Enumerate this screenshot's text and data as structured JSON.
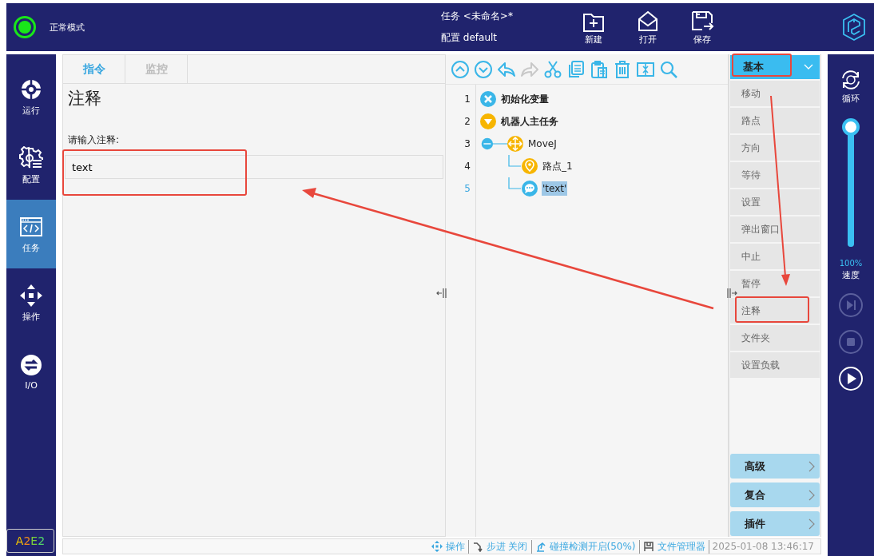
{
  "top_bar": {
    "mode": "正常模式",
    "task_label": "任务",
    "task_value": "<未命名>*",
    "config_label": "配置",
    "config_value": "default",
    "buttons": [
      {
        "kind": "new",
        "label": "新建"
      },
      {
        "kind": "open",
        "label": "打开"
      },
      {
        "kind": "save",
        "label": "保存"
      }
    ]
  },
  "sidebar": {
    "items": [
      {
        "kind": "run",
        "label": "运行",
        "selected": false
      },
      {
        "kind": "config",
        "label": "配置",
        "selected": false
      },
      {
        "kind": "task",
        "label": "任务",
        "selected": true
      },
      {
        "kind": "operate",
        "label": "操作",
        "selected": false
      },
      {
        "kind": "io",
        "label": "I/O",
        "selected": false
      }
    ],
    "badge": [
      {
        "text": "A",
        "color": "#f2c200"
      },
      {
        "text": "2",
        "color": "#f08a1c"
      },
      {
        "text": "E",
        "color": "#7bd13a"
      },
      {
        "text": "2",
        "color": "#52d96a"
      }
    ]
  },
  "tabs": [
    {
      "label": "指令",
      "selected": true
    },
    {
      "label": "监控",
      "selected": false
    }
  ],
  "panel": {
    "title": "注释",
    "prompt": "请输入注释:",
    "value": "text"
  },
  "toolbar": [
    {
      "kind": "up",
      "disabled": false
    },
    {
      "kind": "down",
      "disabled": false
    },
    {
      "kind": "undo",
      "disabled": false
    },
    {
      "kind": "redo",
      "disabled": true
    },
    {
      "kind": "cut",
      "disabled": false
    },
    {
      "kind": "copy",
      "disabled": false
    },
    {
      "kind": "paste",
      "disabled": false
    },
    {
      "kind": "delete",
      "disabled": false
    },
    {
      "kind": "insert",
      "disabled": false
    },
    {
      "kind": "search",
      "disabled": false
    }
  ],
  "program": [
    {
      "line": "1",
      "kind": "init",
      "label": "初始化变量",
      "selected": false
    },
    {
      "line": "2",
      "kind": "main",
      "label": "机器人主任务",
      "selected": false,
      "children": [
        {
          "line": "3",
          "kind": "move",
          "label": "MoveJ",
          "selected": false,
          "expanded": true,
          "children": [
            {
              "line": "4",
              "kind": "waypoint",
              "label": "路点_1",
              "selected": false
            },
            {
              "line": "5",
              "kind": "comment",
              "label": "'text'",
              "selected": true
            }
          ]
        }
      ]
    }
  ],
  "palette": {
    "category": "基本",
    "items": [
      {
        "label": "移动"
      },
      {
        "label": "路点"
      },
      {
        "label": "方向"
      },
      {
        "label": "等待"
      },
      {
        "label": "设置"
      },
      {
        "label": "弹出窗口"
      },
      {
        "label": "中止"
      },
      {
        "label": "暂停"
      },
      {
        "label": "注释"
      },
      {
        "label": "文件夹"
      },
      {
        "label": "设置负载"
      }
    ],
    "groups": [
      {
        "label": "高级"
      },
      {
        "label": "复合"
      },
      {
        "label": "插件"
      }
    ]
  },
  "right_bar": {
    "loop_label": "循环",
    "speed": {
      "level": 1.0,
      "reading": "100%",
      "label": "速度"
    },
    "controls": [
      {
        "kind": "step",
        "disabled": true
      },
      {
        "kind": "stop",
        "disabled": true
      },
      {
        "kind": "play",
        "disabled": false
      }
    ]
  },
  "status_bar": [
    {
      "kind": "operate",
      "text": "操作"
    },
    {
      "kind": "step",
      "text": "步进 关闭"
    },
    {
      "kind": "collision",
      "text": "碰撞检测开启(50%)"
    },
    {
      "kind": "files",
      "text": "文件管理器"
    },
    {
      "kind": "time",
      "text": "2025-01-08 13:46:17"
    }
  ]
}
